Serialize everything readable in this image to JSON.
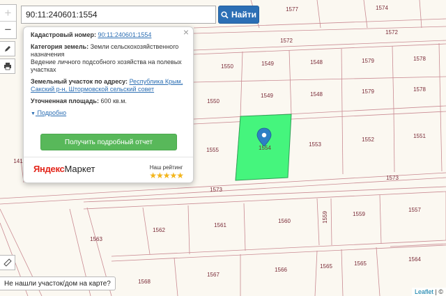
{
  "search": {
    "value": "90:11:240601:1554",
    "button_label": "Найти",
    "icon": "search-icon"
  },
  "controls": {
    "zoom_in": "+",
    "zoom_out": "−",
    "edit_icon": "pencil-icon",
    "print_icon": "printer-icon",
    "ruler_icon": "ruler-icon"
  },
  "popup": {
    "cadastral_label": "Кадастровый номер:",
    "cadastral_value": "90:11:240601:1554",
    "category_label": "Категория земель:",
    "category_value_1": "Земли сельскохозяйственного назначения",
    "category_value_2": "Ведение личного подсобного хозяйства на полевых участках",
    "address_label": "Земельный участок по адресу:",
    "address_value": "Республика Крым, Сакский р-н, Штормовской сельский совет",
    "area_label": "Уточненная площадь:",
    "area_value": "600 кв.м.",
    "details_link": "Подробно",
    "report_button": "Получить подробный отчет",
    "market_logo_part1": "Яндекс",
    "market_logo_part2": "Маркет",
    "rating_label": "Наш рейтинг",
    "rating_stars": "★★★★★",
    "close": "×"
  },
  "map": {
    "selected_parcel": "1554",
    "highlight_color": "#45f57d",
    "parcels": [
      "1577",
      "1574",
      "1572",
      "1550",
      "1549",
      "1548",
      "1579",
      "1578",
      "1550",
      "1549",
      "1548",
      "1579",
      "1578",
      "1555",
      "1553",
      "1552",
      "1551",
      "1573",
      "1573",
      "1562",
      "1561",
      "1560",
      "1559",
      "1559",
      "1557",
      "1563",
      "1564",
      "1565",
      "1565",
      "1566",
      "1567",
      "1568",
      "141"
    ]
  },
  "footer": {
    "not_found": "Не нашли участок/дом на карте?",
    "attribution_link": "Leaflet",
    "attribution_rest": "| ©"
  }
}
